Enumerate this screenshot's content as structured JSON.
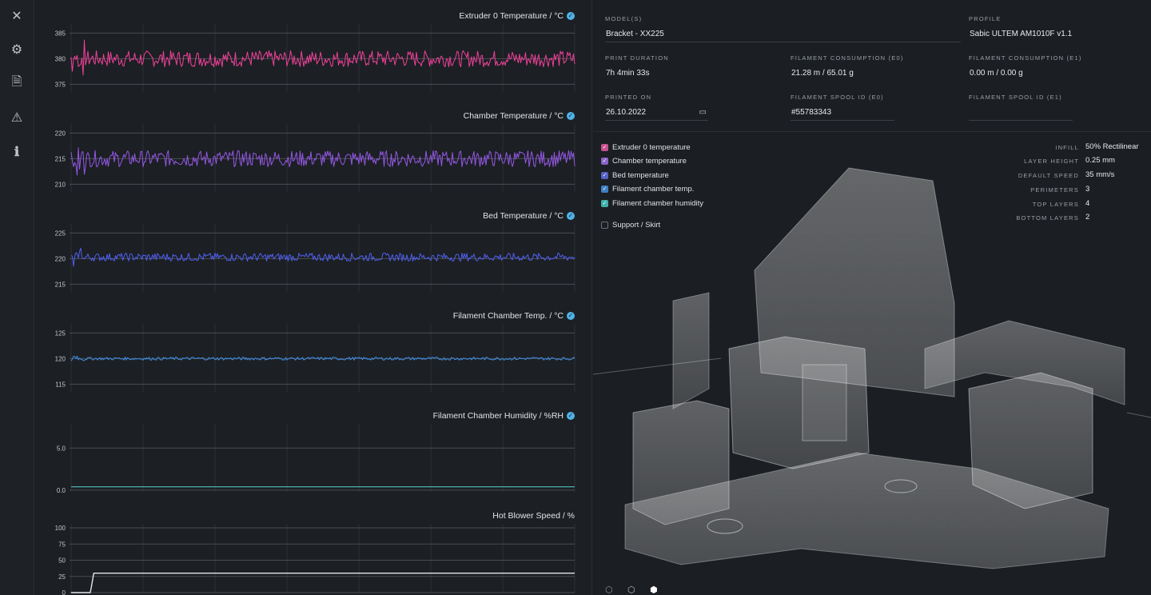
{
  "sidebar": {
    "items": [
      {
        "name": "close-icon",
        "glyph": "✕"
      },
      {
        "name": "gear-icon",
        "glyph": "⚙"
      },
      {
        "name": "pdf-file-icon",
        "glyph": "🗎"
      },
      {
        "name": "warning-icon",
        "glyph": "⚠"
      },
      {
        "name": "info-icon",
        "glyph": "ℹ"
      }
    ]
  },
  "charts_colors": {
    "extruder": "#f0409a",
    "chamber": "#9457e6",
    "bed": "#4f5ff0",
    "filament_temp": "#3d8fe8",
    "humidity": "#59d6cf",
    "blower": "#e5e7ea"
  },
  "chart_data": [
    {
      "type": "line",
      "title": "Extruder 0 Temperature / °C",
      "yticks": [
        385,
        380,
        375
      ],
      "ylim": [
        373.5,
        386
      ],
      "series": [
        {
          "values_mean": 380,
          "noise": 1.6
        }
      ],
      "grid": true
    },
    {
      "type": "line",
      "title": "Chamber Temperature / °C",
      "yticks": [
        220,
        215,
        210
      ],
      "ylim": [
        208.5,
        221
      ],
      "series": [
        {
          "values_mean": 215,
          "noise": 1.6
        }
      ],
      "grid": true
    },
    {
      "type": "line",
      "title": "Bed Temperature / °C",
      "yticks": [
        225,
        220,
        215
      ],
      "ylim": [
        213.5,
        226
      ],
      "series": [
        {
          "values_mean": 220.3,
          "noise": 0.8
        }
      ],
      "grid": true
    },
    {
      "type": "line",
      "title": "Filament Chamber Temp. / °C",
      "yticks": [
        125,
        120,
        115
      ],
      "ylim": [
        113.5,
        126
      ],
      "series": [
        {
          "values_mean": 120,
          "noise": 0.3
        }
      ],
      "grid": true
    },
    {
      "type": "line",
      "title": "Filament Chamber Humidity / %RH",
      "yticks": [
        "5.0",
        "0.0"
      ],
      "ylim": [
        -0.2,
        7.4
      ],
      "series": [
        {
          "values_mean": 0.4,
          "noise": 0
        }
      ],
      "grid": true
    },
    {
      "type": "line",
      "title": "Hot Blower Speed / %",
      "yticks": [
        100,
        75,
        50,
        25,
        0
      ],
      "ylim": [
        0,
        100
      ],
      "series": [
        {
          "steps": [
            [
              0,
              0
            ],
            [
              0.038,
              0
            ],
            [
              0.04,
              8
            ],
            [
              0.045,
              30
            ],
            [
              1,
              30
            ]
          ]
        }
      ],
      "grid": true
    }
  ],
  "info": {
    "models_label": "MODEL(S)",
    "models_value": "Bracket - XX225",
    "profile_label": "PROFILE",
    "profile_value": "Sabic ULTEM AM1010F v1.1",
    "duration_label": "PRINT DURATION",
    "duration_value": "7h 4min 33s",
    "consumption_e0_label": "FILAMENT CONSUMPTION (E0)",
    "consumption_e0_value": "21.28 m / 65.01 g",
    "consumption_e1_label": "FILAMENT CONSUMPTION (E1)",
    "consumption_e1_value": "0.00 m / 0.00 g",
    "printed_on_label": "PRINTED ON",
    "printed_on_value": "26.10.2022",
    "spool_e0_label": "FILAMENT SPOOL ID (E0)",
    "spool_e0_value": "#55783343",
    "spool_e1_label": "FILAMENT SPOOL ID (E1)",
    "spool_e1_value": ""
  },
  "legend": [
    {
      "label": "Extruder 0 temperature",
      "color": "#c4508e",
      "checked": true
    },
    {
      "label": "Chamber temperature",
      "color": "#8a63c7",
      "checked": true
    },
    {
      "label": "Bed temperature",
      "color": "#5462c4",
      "checked": true
    },
    {
      "label": "Filament chamber temp.",
      "color": "#3f7fc2",
      "checked": true
    },
    {
      "label": "Filament chamber humidity",
      "color": "#3fb0a9",
      "checked": true
    },
    {
      "label": "Support / Skirt",
      "color": "",
      "checked": false
    }
  ],
  "params": [
    {
      "label": "INFILL",
      "value": "50% Rectilinear"
    },
    {
      "label": "LAYER HEIGHT",
      "value": "0.25 mm"
    },
    {
      "label": "DEFAULT SPEED",
      "value": "35 mm/s"
    },
    {
      "label": "PERIMETERS",
      "value": "3"
    },
    {
      "label": "TOP LAYERS",
      "value": "4"
    },
    {
      "label": "BOTTOM LAYERS",
      "value": "2"
    }
  ]
}
